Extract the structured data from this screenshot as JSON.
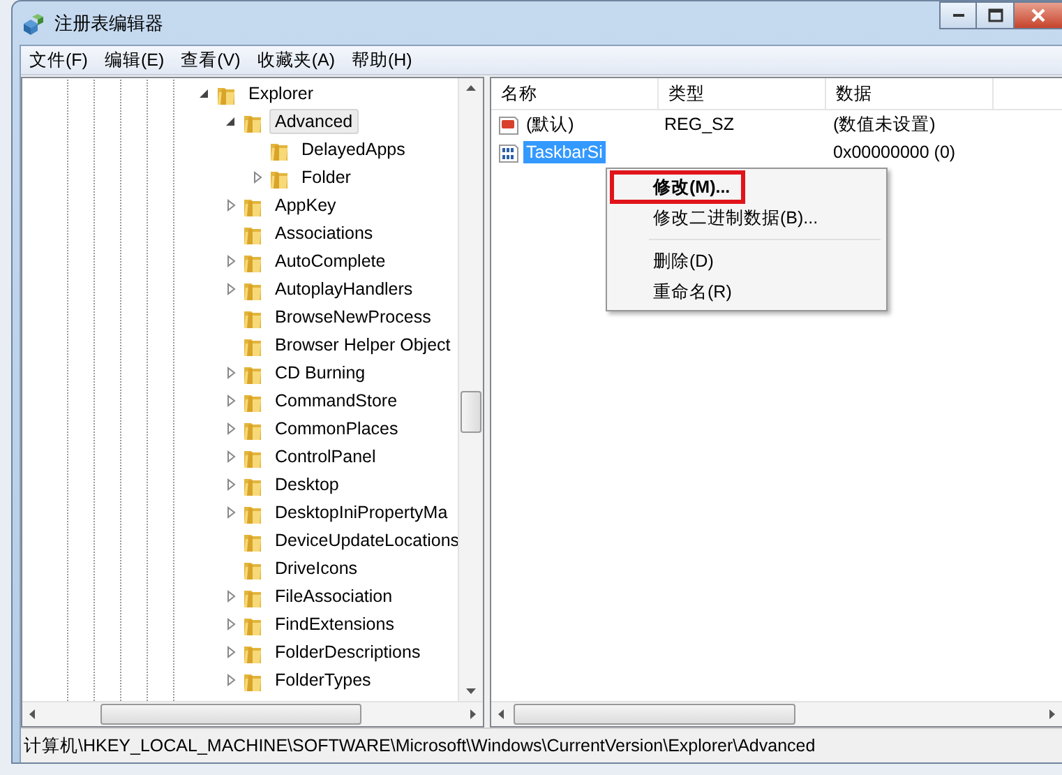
{
  "window": {
    "title": "注册表编辑器"
  },
  "menu": [
    "文件(F)",
    "编辑(E)",
    "查看(V)",
    "收藏夹(A)",
    "帮助(H)"
  ],
  "tree": [
    {
      "label": "Explorer",
      "expandable": true,
      "expanded": true,
      "selected": false,
      "children": [
        {
          "label": "Advanced",
          "expandable": true,
          "expanded": true,
          "selected": true,
          "children": [
            {
              "label": "DelayedApps",
              "expandable": false,
              "expanded": false,
              "selected": false
            },
            {
              "label": "Folder",
              "expandable": true,
              "expanded": false,
              "selected": false
            }
          ]
        },
        {
          "label": "AppKey",
          "expandable": true,
          "expanded": false,
          "selected": false
        },
        {
          "label": "Associations",
          "expandable": false,
          "expanded": false,
          "selected": false
        },
        {
          "label": "AutoComplete",
          "expandable": true,
          "expanded": false,
          "selected": false
        },
        {
          "label": "AutoplayHandlers",
          "expandable": true,
          "expanded": false,
          "selected": false
        },
        {
          "label": "BrowseNewProcess",
          "expandable": false,
          "expanded": false,
          "selected": false
        },
        {
          "label": "Browser Helper Object",
          "expandable": false,
          "expanded": false,
          "selected": false
        },
        {
          "label": "CD Burning",
          "expandable": true,
          "expanded": false,
          "selected": false
        },
        {
          "label": "CommandStore",
          "expandable": true,
          "expanded": false,
          "selected": false
        },
        {
          "label": "CommonPlaces",
          "expandable": true,
          "expanded": false,
          "selected": false
        },
        {
          "label": "ControlPanel",
          "expandable": true,
          "expanded": false,
          "selected": false
        },
        {
          "label": "Desktop",
          "expandable": true,
          "expanded": false,
          "selected": false
        },
        {
          "label": "DesktopIniPropertyMa",
          "expandable": true,
          "expanded": false,
          "selected": false
        },
        {
          "label": "DeviceUpdateLocations",
          "expandable": false,
          "expanded": false,
          "selected": false
        },
        {
          "label": "DriveIcons",
          "expandable": false,
          "expanded": false,
          "selected": false
        },
        {
          "label": "FileAssociation",
          "expandable": true,
          "expanded": false,
          "selected": false
        },
        {
          "label": "FindExtensions",
          "expandable": true,
          "expanded": false,
          "selected": false
        },
        {
          "label": "FolderDescriptions",
          "expandable": true,
          "expanded": false,
          "selected": false
        },
        {
          "label": "FolderTypes",
          "expandable": true,
          "expanded": false,
          "selected": false
        }
      ]
    }
  ],
  "values": {
    "columns": [
      "名称",
      "类型",
      "数据"
    ],
    "rows": [
      {
        "kind": "string",
        "name": "(默认)",
        "type": "REG_SZ",
        "data": "(数值未设置)",
        "selected": false
      },
      {
        "kind": "binary",
        "name": "TaskbarSi",
        "data": "0x00000000 (0)",
        "selected": true
      }
    ]
  },
  "context_menu": {
    "items": [
      {
        "kind": "item",
        "label": "修改(M)...",
        "default": true,
        "highlighted": true
      },
      {
        "kind": "item",
        "label": "修改二进制数据(B)...",
        "default": false,
        "highlighted": false
      },
      {
        "kind": "separator"
      },
      {
        "kind": "item",
        "label": "删除(D)",
        "default": false,
        "highlighted": false
      },
      {
        "kind": "item",
        "label": "重命名(R)",
        "default": false,
        "highlighted": false
      }
    ]
  },
  "status_bar": {
    "path": "计算机\\HKEY_LOCAL_MACHINE\\SOFTWARE\\Microsoft\\Windows\\CurrentVersion\\Explorer\\Advanced"
  }
}
